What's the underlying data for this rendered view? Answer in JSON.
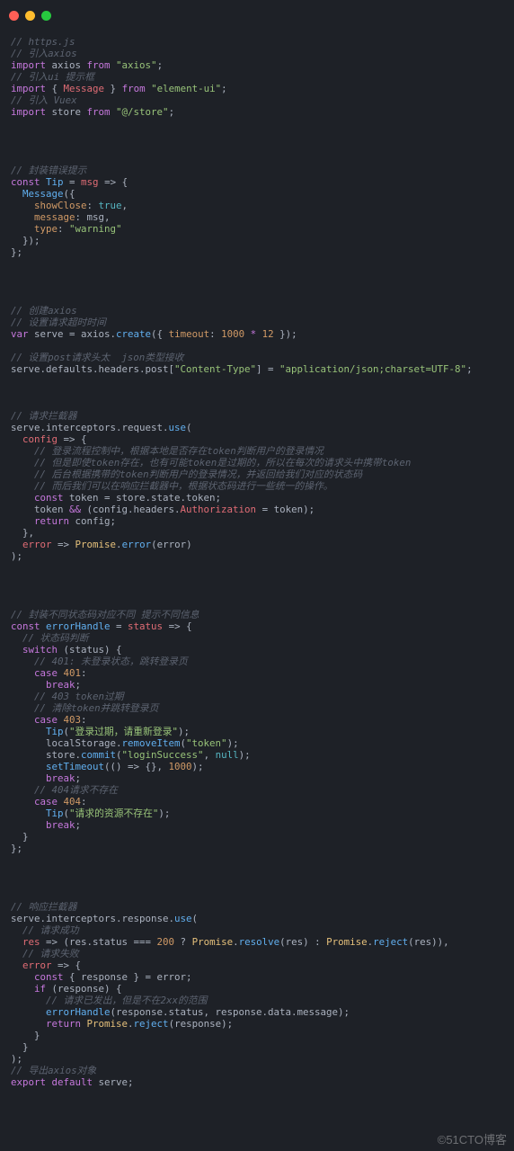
{
  "watermark": "©51CTO博客",
  "traffic": {
    "red": "red",
    "yellow": "yellow",
    "green": "green"
  },
  "code": {
    "l1": "// https.js",
    "l2": "// 引入axios",
    "l3a": "import",
    "l3b": " axios ",
    "l3c": "from",
    "l3d": " \"axios\"",
    "l3e": ";",
    "l4": "// 引入ui 提示框",
    "l5a": "import",
    "l5b": " { ",
    "l5c": "Message",
    "l5d": " } ",
    "l5e": "from",
    "l5f": " \"element-ui\"",
    "l5g": ";",
    "l6": "// 引入 Vuex",
    "l7a": "import",
    "l7b": " store ",
    "l7c": "from",
    "l7d": " \"@/store\"",
    "l7e": ";",
    "l8": "// 封装错误提示",
    "l9a": "const",
    "l9b": " Tip",
    "l9c": " = ",
    "l9d": "msg",
    "l9e": " => {",
    "l10a": "  Message",
    "l10b": "({",
    "l11a": "    showClose",
    "l11b": ": ",
    "l11c": "true",
    "l11d": ",",
    "l12a": "    message",
    "l12b": ": msg,",
    "l13a": "    type",
    "l13b": ": ",
    "l13c": "\"warning\"",
    "l14": "  });",
    "l15": "};",
    "l16": "// 创建axios",
    "l17": "// 设置请求超时时间",
    "l18a": "var",
    "l18b": " serve = axios.",
    "l18c": "create",
    "l18d": "({ ",
    "l18e": "timeout",
    "l18f": ": ",
    "l18g": "1000",
    "l18h": " * ",
    "l18i": "12",
    "l18j": " });",
    "l19": "// 设置post请求头太  json类型接收",
    "l20a": "serve.defaults.headers.post[",
    "l20b": "\"Content-Type\"",
    "l20c": "] = ",
    "l20d": "\"application/json;charset=UTF-8\"",
    "l20e": ";",
    "l21": "// 请求拦截器",
    "l22a": "serve.interceptors.request.",
    "l22b": "use",
    "l22c": "(",
    "l23a": "  config",
    "l23b": " => {",
    "l24": "    // 登录流程控制中，根据本地是否存在token判断用户的登录情况",
    "l25": "    // 但是即使token存在，也有可能token是过期的，所以在每次的请求头中携带token",
    "l26": "    // 后台根据携带的token判断用户的登录情况，并返回给我们对应的状态码",
    "l27": "    // 而后我们可以在响应拦截器中，根据状态码进行一些统一的操作。",
    "l28a": "    const",
    "l28b": " token = store.state.token;",
    "l29a": "    token ",
    "l29b": "&&",
    "l29c": " (config.headers.",
    "l29d": "Authorization",
    "l29e": " = token);",
    "l30a": "    return",
    "l30b": " config;",
    "l31": "  },",
    "l32a": "  error",
    "l32b": " => ",
    "l32c": "Promise",
    "l32d": ".",
    "l32e": "error",
    "l32f": "(error)",
    "l33": ");",
    "l34": "// 封装不同状态码对应不同 提示不同信息",
    "l35a": "const",
    "l35b": " errorHandle",
    "l35c": " = ",
    "l35d": "status",
    "l35e": " => {",
    "l36": "  // 状态码判断",
    "l37a": "  switch",
    "l37b": " (status) {",
    "l38": "    // 401: 未登录状态，跳转登录页",
    "l39a": "    case",
    "l39b": " 401",
    "l39c": ":",
    "l40a": "      break",
    "l40b": ";",
    "l41": "    // 403 token过期",
    "l42": "    // 清除token并跳转登录页",
    "l43a": "    case",
    "l43b": " 403",
    "l43c": ":",
    "l44a": "      Tip",
    "l44b": "(",
    "l44c": "\"登录过期，请重新登录\"",
    "l44d": ");",
    "l45a": "      localStorage.",
    "l45b": "removeItem",
    "l45c": "(",
    "l45d": "\"token\"",
    "l45e": ");",
    "l46a": "      store.",
    "l46b": "commit",
    "l46c": "(",
    "l46d": "\"loginSuccess\"",
    "l46e": ", ",
    "l46f": "null",
    "l46g": ");",
    "l47a": "      setTimeout",
    "l47b": "(() => {}, ",
    "l47c": "1000",
    "l47d": ");",
    "l48a": "      break",
    "l48b": ";",
    "l49": "    // 404请求不存在",
    "l50a": "    case",
    "l50b": " 404",
    "l50c": ":",
    "l51a": "      Tip",
    "l51b": "(",
    "l51c": "\"请求的资源不存在\"",
    "l51d": ");",
    "l52a": "      break",
    "l52b": ";",
    "l53": "  }",
    "l54": "};",
    "l55": "// 响应拦截器",
    "l56a": "serve.interceptors.response.",
    "l56b": "use",
    "l56c": "(",
    "l57": "  // 请求成功",
    "l58a": "  res",
    "l58b": " => (res.status === ",
    "l58c": "200",
    "l58d": " ? ",
    "l58e": "Promise",
    "l58f": ".",
    "l58g": "resolve",
    "l58h": "(res) : ",
    "l58i": "Promise",
    "l58j": ".",
    "l58k": "reject",
    "l58l": "(res)),",
    "l59": "  // 请求失败",
    "l60a": "  error",
    "l60b": " => {",
    "l61a": "    const",
    "l61b": " { response } = error;",
    "l62a": "    if",
    "l62b": " (response) {",
    "l63": "      // 请求已发出，但是不在2xx的范围",
    "l64a": "      errorHandle",
    "l64b": "(response.status, response.data.message);",
    "l65a": "      return",
    "l65b": " Promise",
    "l65c": ".",
    "l65d": "reject",
    "l65e": "(response);",
    "l66": "    }",
    "l67": "  }",
    "l68": ");",
    "l69": "// 导出axios对象",
    "l70a": "export",
    "l70b": " default",
    "l70c": " serve;"
  }
}
